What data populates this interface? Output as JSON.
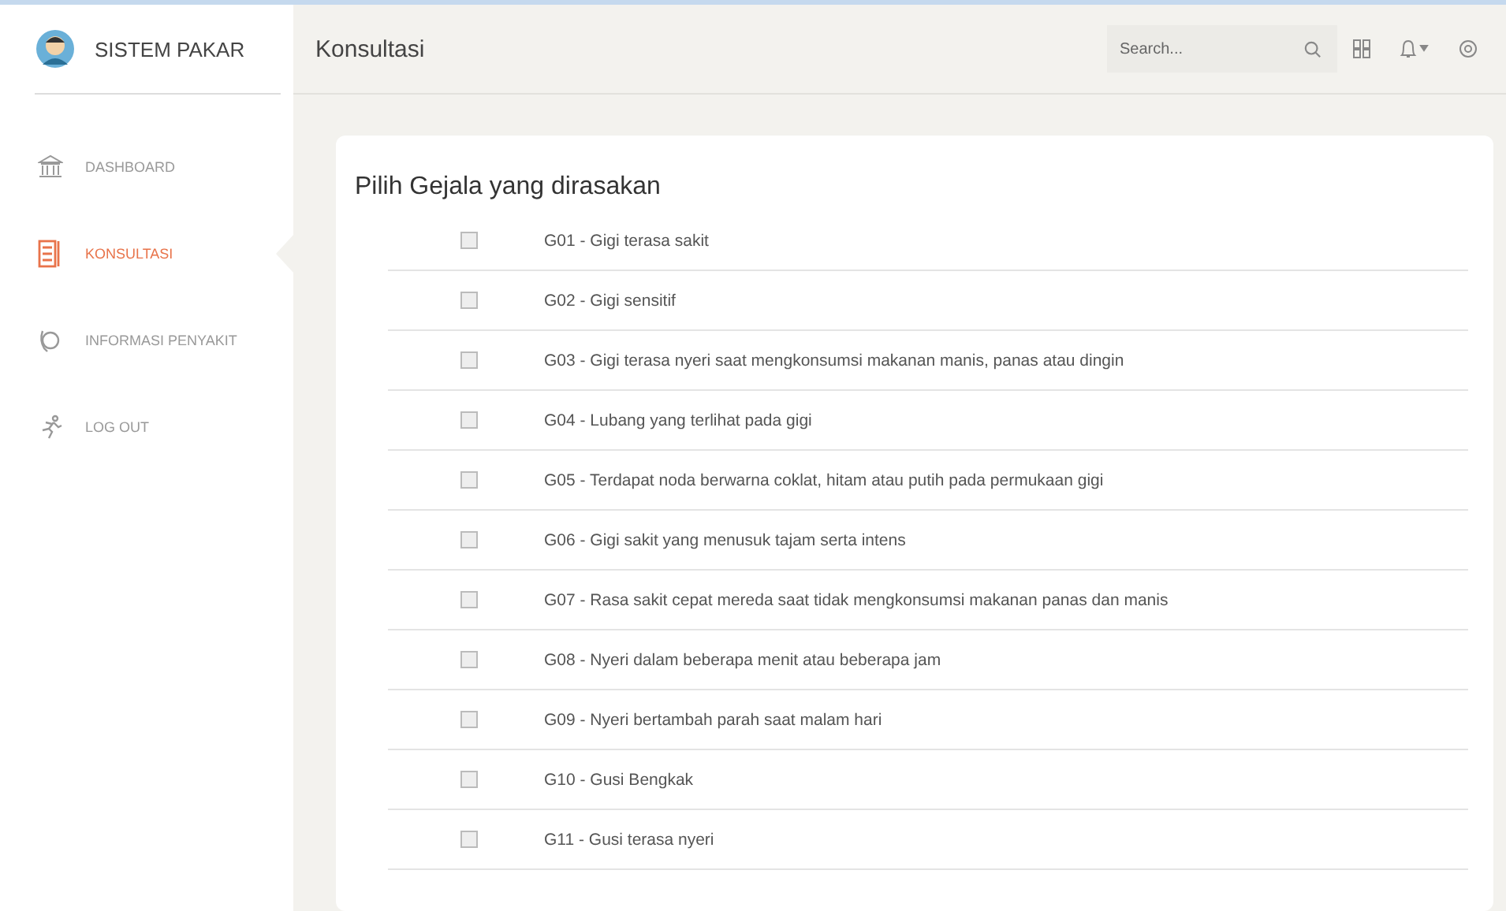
{
  "sidebar": {
    "brand": "SISTEM PAKAR",
    "items": [
      {
        "label": "DASHBOARD",
        "selected": false
      },
      {
        "label": "KONSULTASI",
        "selected": true
      },
      {
        "label": "INFORMASI PENYAKIT",
        "selected": false
      },
      {
        "label": "LOG OUT",
        "selected": false
      }
    ]
  },
  "header": {
    "title": "Konsultasi",
    "search": {
      "placeholder": "Search..."
    }
  },
  "card": {
    "title": "Pilih Gejala yang dirasakan",
    "symptoms": [
      {
        "label": "G01 - Gigi terasa sakit",
        "checked": false
      },
      {
        "label": "G02 - Gigi sensitif",
        "checked": false
      },
      {
        "label": "G03 - Gigi terasa nyeri saat mengkonsumsi makanan manis, panas atau dingin",
        "checked": false
      },
      {
        "label": "G04 - Lubang yang terlihat pada gigi",
        "checked": false
      },
      {
        "label": "G05 - Terdapat noda berwarna coklat, hitam atau putih pada permukaan gigi",
        "checked": false
      },
      {
        "label": "G06 - Gigi sakit yang menusuk tajam serta intens",
        "checked": false
      },
      {
        "label": "G07 - Rasa sakit cepat mereda saat tidak mengkonsumsi makanan panas dan manis",
        "checked": false
      },
      {
        "label": "G08 - Nyeri dalam beberapa menit atau beberapa jam",
        "checked": false
      },
      {
        "label": "G09 - Nyeri bertambah parah saat malam hari",
        "checked": false
      },
      {
        "label": "G10 - Gusi Bengkak",
        "checked": false
      },
      {
        "label": "G11 - Gusi terasa nyeri",
        "checked": false
      }
    ]
  }
}
